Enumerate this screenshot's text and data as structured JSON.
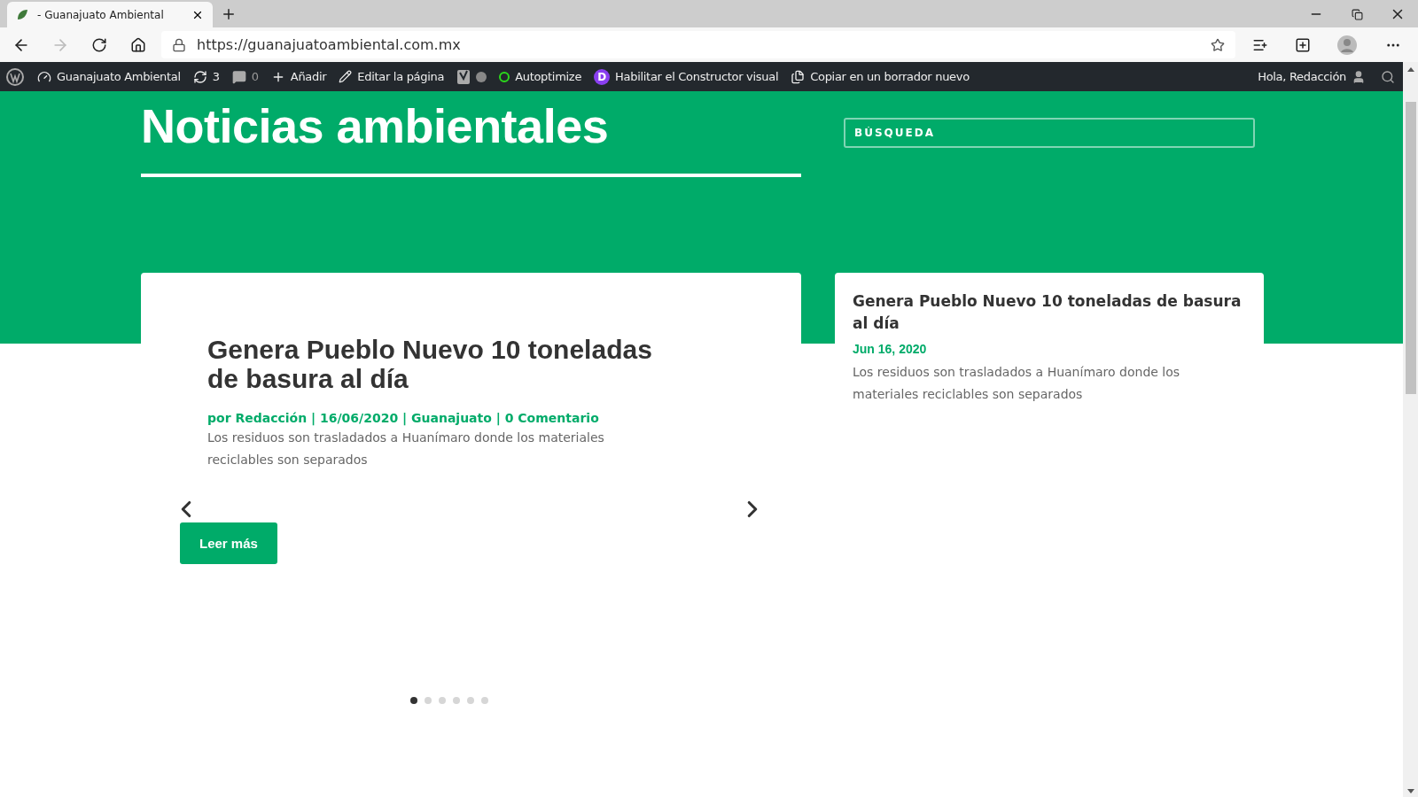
{
  "browser": {
    "tab": {
      "title": "- Guanajuato Ambiental",
      "selected": true
    },
    "url": "https://guanajuatoambiental.com.mx"
  },
  "admin_bar": {
    "items": [
      {
        "kind": "link",
        "label": "Guanajuato Ambiental"
      },
      {
        "kind": "link",
        "label": "3"
      },
      {
        "kind": "link",
        "label": "0"
      },
      {
        "kind": "link",
        "label": "Añadir"
      },
      {
        "kind": "link",
        "label": "Editar la página"
      },
      {
        "kind": "seo"
      },
      {
        "kind": "link",
        "label": "Autoptimize"
      },
      {
        "kind": "link",
        "badge": "D",
        "label": "Habilitar el Constructor visual"
      },
      {
        "kind": "link",
        "label": "Copiar en un borrador nuevo"
      }
    ],
    "greeting": "Hola, Redacción"
  },
  "hero": {
    "title": "Noticias ambientales",
    "search": {
      "placeholder": "BÚSQUEDA"
    }
  },
  "slider": {
    "title": "Genera Pueblo Nuevo 10 toneladas de basura al día",
    "meta": "por Redacción | 16/06/2020 | Guanajuato | 0 Comentario",
    "excerpt": "Los residuos son trasladados a Huanímaro donde los materiales reciclables son separados",
    "button": "Leer más",
    "dots": [
      {
        "selected": true
      },
      {
        "selected": false
      },
      {
        "selected": false
      },
      {
        "selected": false
      },
      {
        "selected": false
      },
      {
        "selected": false
      }
    ]
  },
  "side_post": {
    "title": "Genera Pueblo Nuevo 10 toneladas de basura al día",
    "date": "Jun 16, 2020",
    "excerpt": "Los residuos son trasladados a Huanímaro donde los materiales reciclables son separados"
  }
}
